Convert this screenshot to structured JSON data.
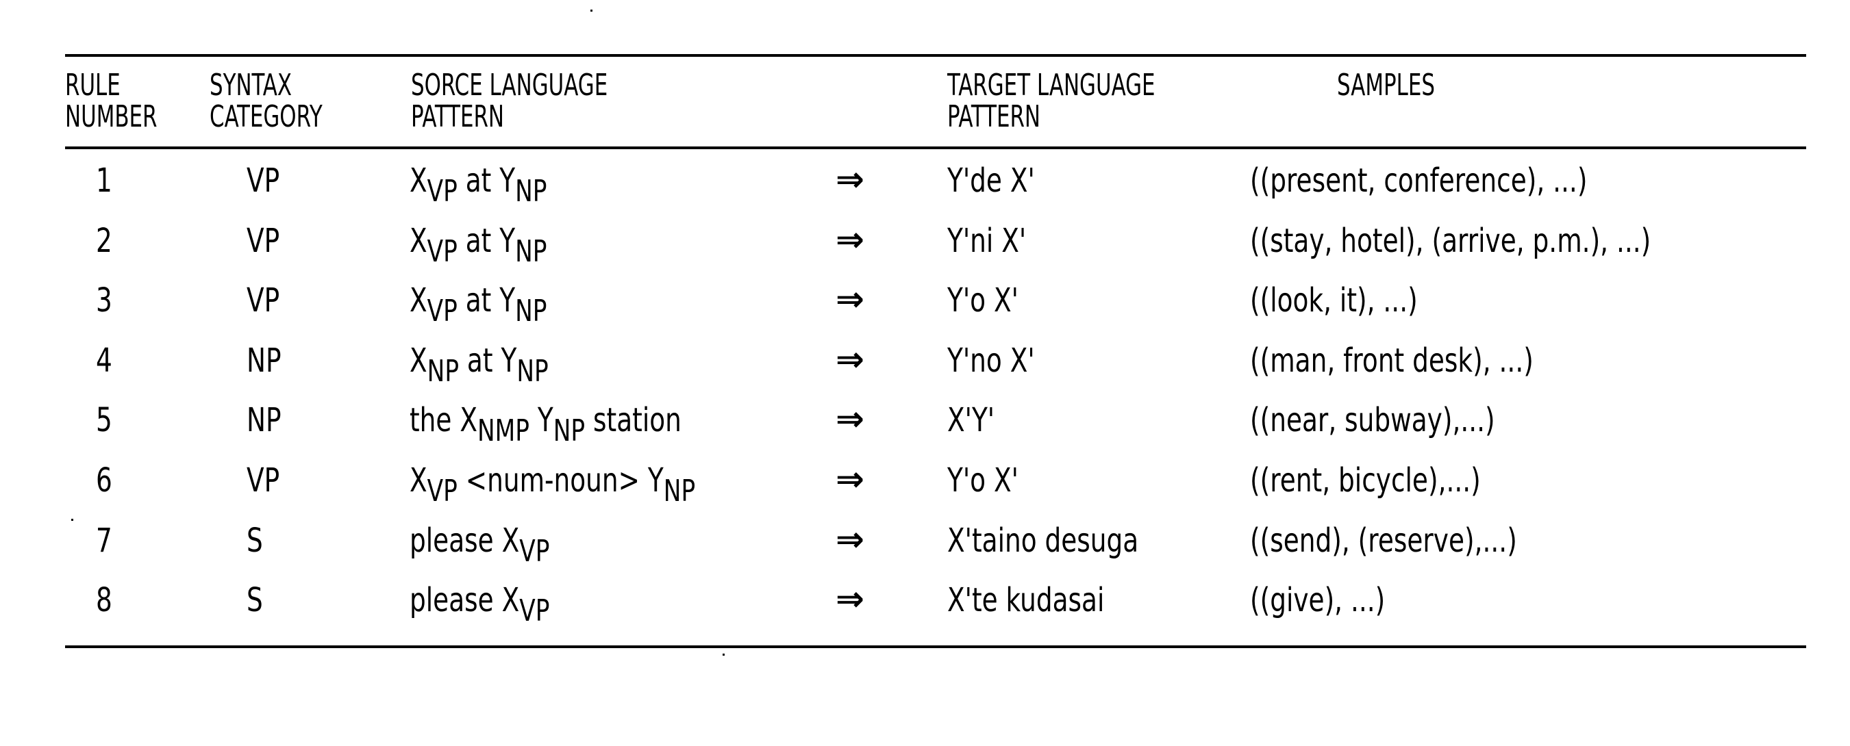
{
  "table": {
    "headers": {
      "rule_number": [
        "RULE",
        "NUMBER"
      ],
      "syntax_category": [
        "SYNTAX",
        "CATEGORY"
      ],
      "source_pattern": [
        "SORCE LANGUAGE",
        "PATTERN"
      ],
      "target_pattern": [
        "TARGET LANGUAGE",
        "PATTERN"
      ],
      "samples": [
        "SAMPLES"
      ]
    },
    "arrow_symbol": "⇒",
    "rows": [
      {
        "number": "1",
        "category": "VP",
        "source": [
          {
            "t": "X"
          },
          {
            "sub": "VP"
          },
          {
            "t": " at Y"
          },
          {
            "sub": "NP"
          }
        ],
        "target": "Y'de X'",
        "samples": "((present, conference), ...)"
      },
      {
        "number": "2",
        "category": "VP",
        "source": [
          {
            "t": "X"
          },
          {
            "sub": "VP"
          },
          {
            "t": " at Y"
          },
          {
            "sub": "NP"
          }
        ],
        "target": "Y'ni X'",
        "samples": "((stay, hotel), (arrive, p.m.), ...)"
      },
      {
        "number": "3",
        "category": "VP",
        "source": [
          {
            "t": "X"
          },
          {
            "sub": "VP"
          },
          {
            "t": " at Y"
          },
          {
            "sub": "NP"
          }
        ],
        "target": "Y'o X'",
        "samples": "((look, it), ...)"
      },
      {
        "number": "4",
        "category": "NP",
        "source": [
          {
            "t": "X"
          },
          {
            "sub": "NP"
          },
          {
            "t": " at Y"
          },
          {
            "sub": "NP"
          }
        ],
        "target": "Y'no X'",
        "samples": "((man, front desk), ...)"
      },
      {
        "number": "5",
        "category": "NP",
        "source": [
          {
            "t": "the X"
          },
          {
            "sub": "NMP"
          },
          {
            "t": " Y"
          },
          {
            "sub": "NP"
          },
          {
            "t": " station"
          }
        ],
        "target": "X'Y'",
        "samples": "((near, subway),...)"
      },
      {
        "number": "6",
        "category": "VP",
        "source": [
          {
            "t": "X"
          },
          {
            "sub": "VP"
          },
          {
            "t": " <num-noun> Y"
          },
          {
            "sub": "NP"
          }
        ],
        "target": "Y'o X'",
        "samples": "((rent, bicycle),...)"
      },
      {
        "number": "7",
        "category": "S",
        "source": [
          {
            "t": "please X"
          },
          {
            "sub": "VP"
          }
        ],
        "target": "X'taino desuga",
        "samples": "((send), (reserve),...)"
      },
      {
        "number": "8",
        "category": "S",
        "source": [
          {
            "t": "please X"
          },
          {
            "sub": "VP"
          }
        ],
        "target": "X'te kudasai",
        "samples": "((give), ...)"
      }
    ]
  }
}
